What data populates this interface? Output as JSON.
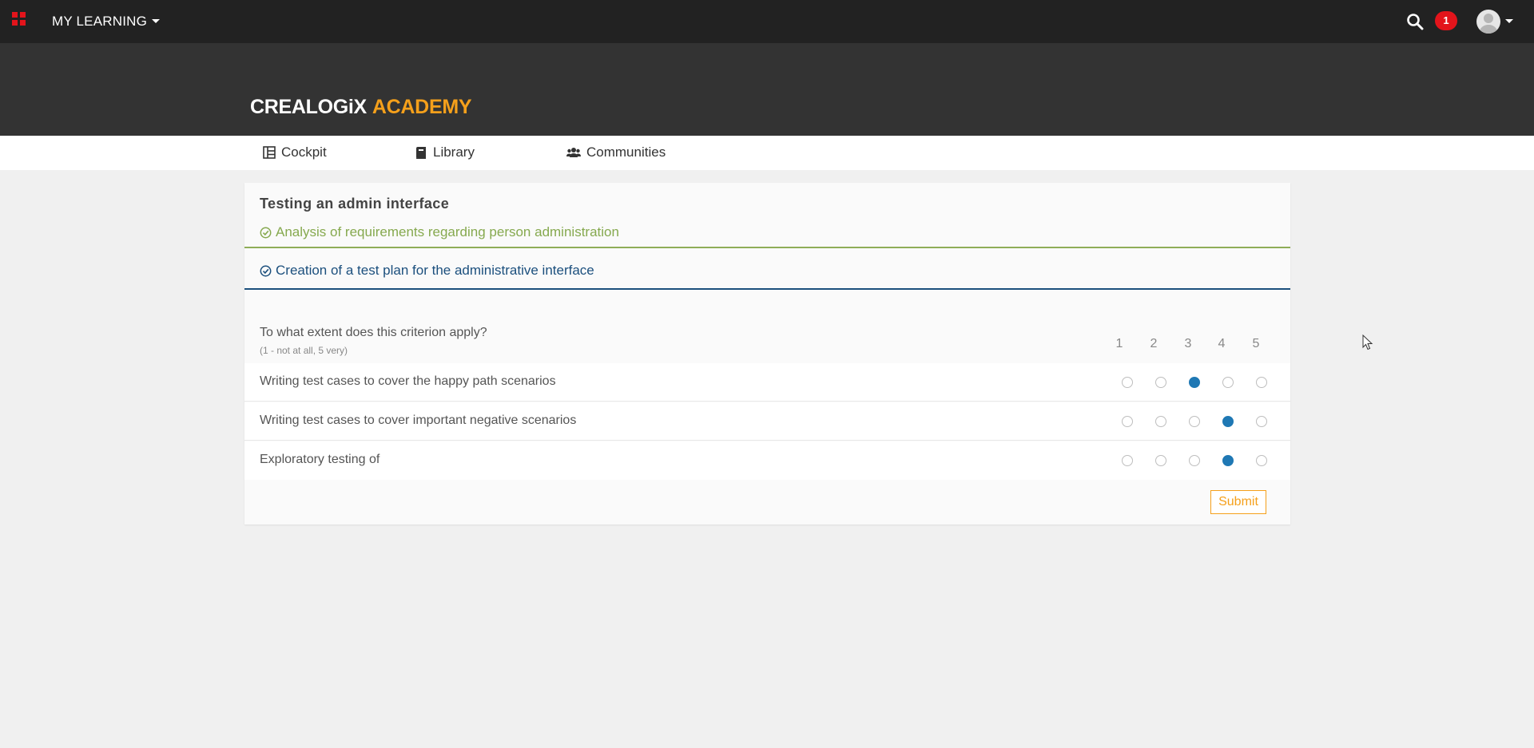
{
  "topbar": {
    "app_menu_label": "MY LEARNING",
    "notification_count": "1"
  },
  "brand": {
    "logo_part1": "CREALOGiX",
    "logo_part2": "ACADEMY",
    "accent_color": "#f5a01b"
  },
  "nav": {
    "items": [
      {
        "label": "Cockpit",
        "icon": "dashboard-icon"
      },
      {
        "label": "Library",
        "icon": "book-icon"
      },
      {
        "label": "Communities",
        "icon": "users-icon"
      }
    ]
  },
  "card": {
    "title": "Testing an admin interface",
    "sections": [
      {
        "label": "Analysis of requirements regarding person administration",
        "status": "complete",
        "color": "#86a94f"
      },
      {
        "label": "Creation of a test plan for the administrative interface",
        "status": "active",
        "color": "#1b4f7d"
      }
    ],
    "question": {
      "text": "To what extent does this criterion apply?",
      "hint": "(1 - not at all, 5 very)",
      "scale": [
        "1",
        "2",
        "3",
        "4",
        "5"
      ]
    },
    "criteria": [
      {
        "label": "Writing test cases to cover the happy path scenarios",
        "selected": 3
      },
      {
        "label": "Writing test cases to cover important negative scenarios",
        "selected": 4
      },
      {
        "label": "Exploratory testing of",
        "selected": 4
      }
    ],
    "submit_label": "Submit"
  }
}
